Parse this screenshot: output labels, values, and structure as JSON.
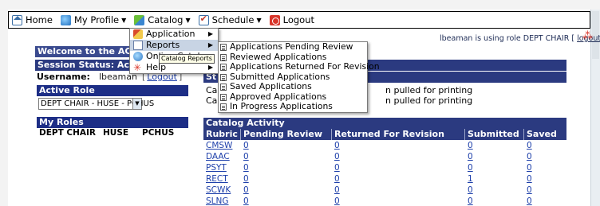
{
  "menubar": {
    "items": [
      {
        "label": "Home",
        "icon": "home-icon"
      },
      {
        "label": "My Profile",
        "icon": "profile-icon"
      },
      {
        "label": "Catalog",
        "icon": "catalog-icon"
      },
      {
        "label": "Schedule",
        "icon": "schedule-icon"
      },
      {
        "label": "Logout",
        "icon": "logout-icon"
      }
    ]
  },
  "catalog_menu": {
    "items": [
      {
        "label": "Application",
        "has_submenu": true
      },
      {
        "label": "Reports",
        "has_submenu": true
      },
      {
        "label": "Online Catalog",
        "has_submenu": false
      },
      {
        "label": "Help",
        "has_submenu": true
      }
    ],
    "tooltip": "Catalog Reports"
  },
  "reports_menu": {
    "items": [
      "Applications Pending Review",
      "Reviewed Applications",
      "Applications Returned For Revision",
      "Submitted Applications",
      "Saved Applications",
      "Approved Applications",
      "In Progress Applications"
    ]
  },
  "role_banner": {
    "text": "lbeaman is using role DEPT CHAIR [",
    "logout": "logout",
    "close": "]"
  },
  "sidebar": {
    "welcome": "Welcome to the ACC Cu",
    "session_status": "Session Status: Active",
    "username_label": "Username:",
    "username_value": "lbeaman",
    "logout_label": "Logout",
    "active_role_title": "Active Role",
    "active_role_value": "DEPT CHAIR - HUSE - PCHUS",
    "my_roles_title": "My Roles",
    "roles": [
      "DEPT CHAIR",
      "HUSE",
      "PCHUS"
    ]
  },
  "main": {
    "header_1": "",
    "header_2": "St",
    "line_1_prefix": "Ca",
    "line_1_suffix": "n pulled for printing",
    "line_2_prefix": "Ca",
    "line_2_suffix": "n pulled for printing",
    "activity_title": "Catalog Activity",
    "columns": [
      "Rubric",
      "Pending Review",
      "Returned For Revision",
      "Submitted",
      "Saved"
    ],
    "rows": [
      [
        "CMSW",
        "0",
        "0",
        "0",
        "0"
      ],
      [
        "DAAC",
        "0",
        "0",
        "0",
        "0"
      ],
      [
        "PSYT",
        "0",
        "0",
        "0",
        "0"
      ],
      [
        "RECT",
        "0",
        "0",
        "1",
        "0"
      ],
      [
        "SCWK",
        "0",
        "0",
        "0",
        "0"
      ],
      [
        "SLNG",
        "0",
        "0",
        "0",
        "0"
      ]
    ]
  },
  "colors": {
    "header_blue": "#2b3a80",
    "link_blue": "#1d3faa",
    "menu_hover": "#c8d4e4"
  }
}
